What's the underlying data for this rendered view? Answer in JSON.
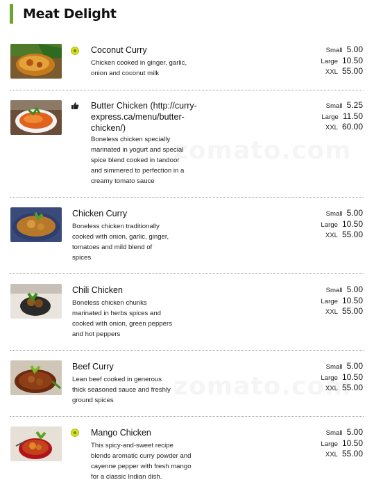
{
  "section": {
    "title": "Meat Delight"
  },
  "items": [
    {
      "name": "Coconut Curry",
      "desc": [
        "Chicken cooked in ginger, garlic,",
        "onion and coconut milk"
      ],
      "badge": "veg-dot-icon",
      "prices": [
        {
          "size": "Small",
          "price": "5.00"
        },
        {
          "size": "Large",
          "price": "10.50"
        },
        {
          "size": "XXL",
          "price": "55.00"
        }
      ]
    },
    {
      "name": [
        "Butter Chicken (http://curry-",
        "express.ca/menu/butter-",
        "chicken/)"
      ],
      "desc": [
        "Boneless chicken specially",
        "marinated in yogurt and special",
        "spice blend cooked in tandoor",
        "and simmered to perfection in a",
        "creamy tomato sauce"
      ],
      "badge": "thumbs-up-icon",
      "prices": [
        {
          "size": "Small",
          "price": "5.25"
        },
        {
          "size": "Large",
          "price": "11.50"
        },
        {
          "size": "XXL",
          "price": "60.00"
        }
      ]
    },
    {
      "name": "Chicken Curry",
      "desc": [
        "Boneless chicken traditionally",
        "cooked with onion, garlic, ginger,",
        "tomatoes and mild blend of",
        "spices"
      ],
      "prices": [
        {
          "size": "Small",
          "price": "5.00"
        },
        {
          "size": "Large",
          "price": "10.50"
        },
        {
          "size": "XXL",
          "price": "55.00"
        }
      ]
    },
    {
      "name": "Chili Chicken",
      "desc": [
        "Boneless chicken chunks",
        "marinated in herbs spices and",
        "cooked with onion, green peppers",
        "and hot peppers"
      ],
      "prices": [
        {
          "size": "Small",
          "price": "5.00"
        },
        {
          "size": "Large",
          "price": "10.50"
        },
        {
          "size": "XXL",
          "price": "55.00"
        }
      ]
    },
    {
      "name": "Beef Curry",
      "desc": [
        "Lean beef cooked in generous",
        "thick seasoned sauce and freshly",
        "ground spices"
      ],
      "prices": [
        {
          "size": "Small",
          "price": "5.00"
        },
        {
          "size": "Large",
          "price": "10.50"
        },
        {
          "size": "XXL",
          "price": "55.00"
        }
      ]
    },
    {
      "name": "Mango Chicken",
      "desc": [
        "This spicy-and-sweet recipe",
        "blends aromatic curry powder and",
        "cayenne pepper with fresh mango",
        "for a classic Indian dish."
      ],
      "badge": "veg-dot-icon",
      "prices": [
        {
          "size": "Small",
          "price": "5.00"
        },
        {
          "size": "Large",
          "price": "10.50"
        },
        {
          "size": "XXL",
          "price": "55.00"
        }
      ]
    }
  ],
  "watermark": "zomato.com",
  "colors": {
    "accent": "#6ba52b",
    "badge": "#d8dc1a"
  }
}
